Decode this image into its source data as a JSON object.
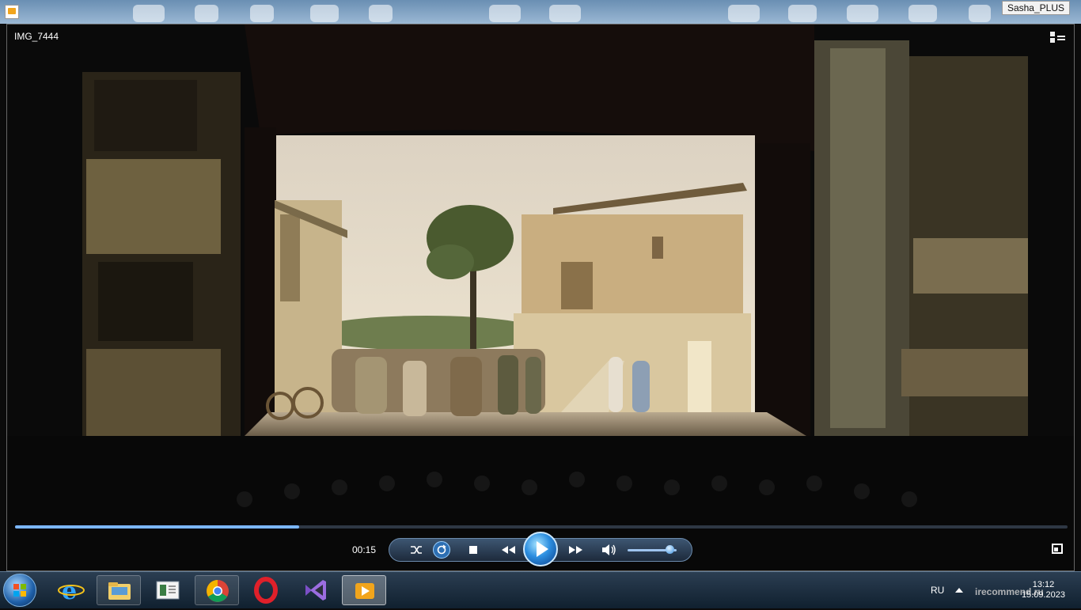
{
  "desktop": {
    "user_label": "Sasha_PLUS"
  },
  "player": {
    "title": "IMG_7444",
    "current_time": "00:15",
    "progress_fraction": 0.27,
    "volume_fraction": 0.85,
    "icons": {
      "switch_to_library": "switch-to-library-icon",
      "shuffle": "shuffle-icon",
      "repeat": "repeat-icon",
      "stop": "stop-icon",
      "previous": "previous-icon",
      "play": "play-icon",
      "next": "next-icon",
      "mute": "speaker-icon",
      "fullscreen": "fullscreen-icon"
    },
    "colors": {
      "accent": "#2c8ee0",
      "seek_fill": "#7bb6ff"
    }
  },
  "taskbar": {
    "language": "RU",
    "time": "13:12",
    "date": "15.09.2023",
    "watermark": "irecommend.ru",
    "items": [
      {
        "name": "internet-explorer",
        "state": "pinned"
      },
      {
        "name": "windows-explorer",
        "state": "pinned"
      },
      {
        "name": "notes",
        "state": "pinned"
      },
      {
        "name": "chrome",
        "state": "pinned"
      },
      {
        "name": "opera",
        "state": "pinned"
      },
      {
        "name": "visual-studio",
        "state": "pinned"
      },
      {
        "name": "windows-media-player",
        "state": "active"
      }
    ]
  }
}
